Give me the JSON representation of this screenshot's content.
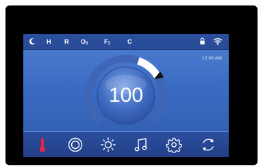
{
  "status_bar": {
    "indicators": [
      {
        "letter": "H",
        "sub": ""
      },
      {
        "letter": "R",
        "sub": ""
      },
      {
        "letter": "O",
        "sub": "3"
      },
      {
        "letter": "F",
        "sub": "1"
      },
      {
        "letter": "C",
        "sub": ""
      }
    ],
    "icons": [
      "moon-icon",
      "lock-icon",
      "wifi-icon"
    ]
  },
  "clock": "12:00 AM",
  "temperature": {
    "value": "100",
    "level": 0.72
  },
  "nav": [
    {
      "name": "thermometer-icon",
      "color": "#e0264a"
    },
    {
      "name": "target-icon",
      "color": "#ffffff"
    },
    {
      "name": "sun-icon",
      "color": "#ffffff"
    },
    {
      "name": "music-note-icon",
      "color": "#ffffff"
    },
    {
      "name": "gear-icon",
      "color": "#ffffff"
    },
    {
      "name": "refresh-icon",
      "color": "#ffffff"
    }
  ],
  "colors": {
    "screen_top": "#4f7fd0",
    "screen_bottom": "#2f5aa9",
    "bars": "#2b4f9f",
    "accent_red": "#e0264a"
  }
}
